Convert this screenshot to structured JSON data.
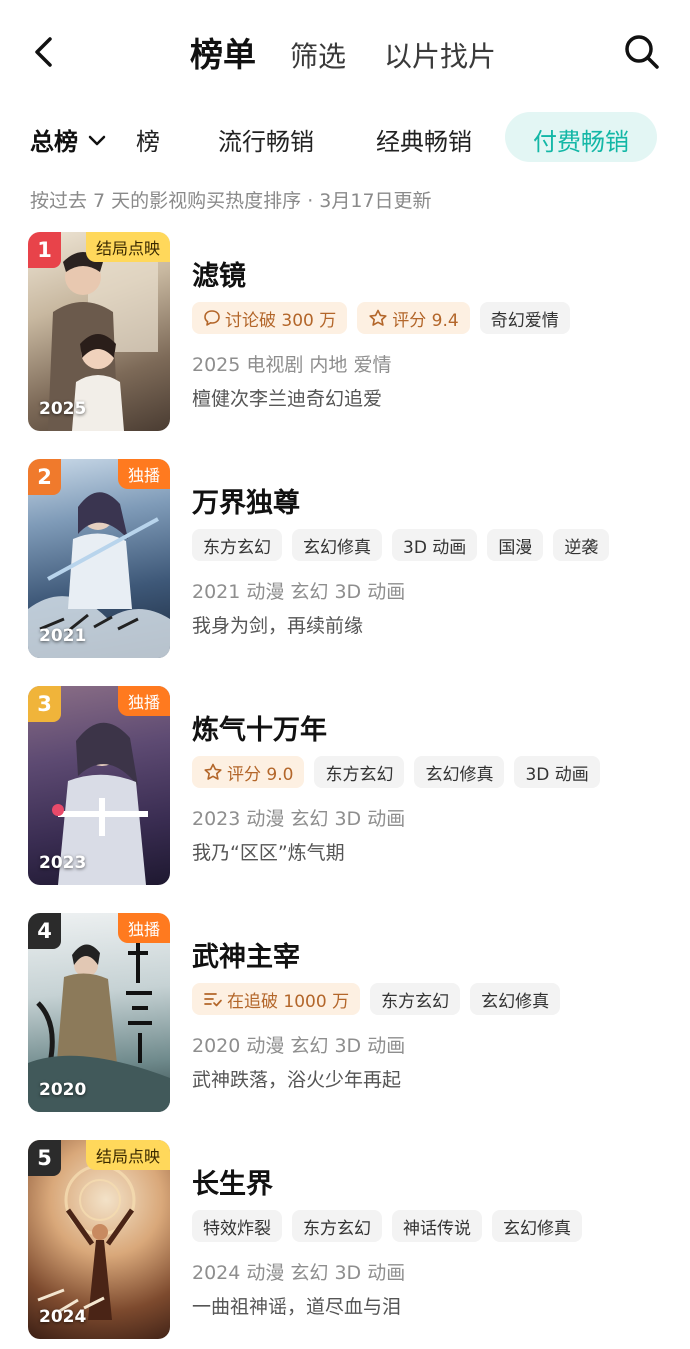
{
  "header": {
    "tabs": [
      {
        "label": "榜单",
        "active": true
      },
      {
        "label": "筛选",
        "active": false
      },
      {
        "label": "以片找片",
        "active": false
      }
    ]
  },
  "categories": {
    "main_label": "总榜",
    "tabs": [
      {
        "label": "榜",
        "active": false
      },
      {
        "label": "流行畅销",
        "active": false
      },
      {
        "label": "经典畅销",
        "active": false
      },
      {
        "label": "付费畅销",
        "active": true
      }
    ]
  },
  "subtitle": "按过去 7 天的影视购买热度排序 · 3月17日更新",
  "colors": {
    "accent": "#13b7a6",
    "accent_bg": "#e3f6f4",
    "rank_red": "#e8434a",
    "rank_orange": "#f07a2c",
    "rank_gold": "#f0b43a",
    "rank_dark": "#2b2b2b",
    "badge_yellow": "#ffd85b",
    "badge_orange": "#ff7a1f",
    "tag_highlight_bg": "#fdf0e2",
    "tag_highlight_text": "#b3662a"
  },
  "items": [
    {
      "rank": "1",
      "badge": "结局点映",
      "badge_style": "yellow",
      "year": "2025",
      "title": "滤镜",
      "tags": [
        {
          "label": "讨论破 300 万",
          "highlight": true,
          "icon": "comment-icon"
        },
        {
          "label": "评分 9.4",
          "highlight": true,
          "icon": "star-icon"
        },
        {
          "label": "奇幻爱情",
          "highlight": false
        }
      ],
      "meta": "2025 电视剧 内地 爱情",
      "desc": "檀健次李兰迪奇幻追爱"
    },
    {
      "rank": "2",
      "badge": "独播",
      "badge_style": "orange",
      "year": "2021",
      "title": "万界独尊",
      "tags": [
        {
          "label": "东方玄幻",
          "highlight": false
        },
        {
          "label": "玄幻修真",
          "highlight": false
        },
        {
          "label": "3D 动画",
          "highlight": false
        },
        {
          "label": "国漫",
          "highlight": false
        },
        {
          "label": "逆袭",
          "highlight": false
        }
      ],
      "meta": "2021 动漫 玄幻 3D 动画",
      "desc": "我身为剑，再续前缘"
    },
    {
      "rank": "3",
      "badge": "独播",
      "badge_style": "orange",
      "year": "2023",
      "title": "炼气十万年",
      "tags": [
        {
          "label": "评分 9.0",
          "highlight": true,
          "icon": "star-icon"
        },
        {
          "label": "东方玄幻",
          "highlight": false
        },
        {
          "label": "玄幻修真",
          "highlight": false
        },
        {
          "label": "3D 动画",
          "highlight": false
        }
      ],
      "meta": "2023 动漫 玄幻 3D 动画",
      "desc": "我乃“区区”炼气期"
    },
    {
      "rank": "4",
      "badge": "独播",
      "badge_style": "orange",
      "year": "2020",
      "title": "武神主宰",
      "tags": [
        {
          "label": "在追破 1000 万",
          "highlight": true,
          "icon": "list-check-icon"
        },
        {
          "label": "东方玄幻",
          "highlight": false
        },
        {
          "label": "玄幻修真",
          "highlight": false
        }
      ],
      "meta": "2020 动漫 玄幻 3D 动画",
      "desc": "武神跌落，浴火少年再起"
    },
    {
      "rank": "5",
      "badge": "结局点映",
      "badge_style": "yellow",
      "year": "2024",
      "title": "长生界",
      "tags": [
        {
          "label": "特效炸裂",
          "highlight": false
        },
        {
          "label": "东方玄幻",
          "highlight": false
        },
        {
          "label": "神话传说",
          "highlight": false
        },
        {
          "label": "玄幻修真",
          "highlight": false
        }
      ],
      "meta": "2024 动漫 玄幻 3D 动画",
      "desc": "一曲祖神谣，道尽血与泪"
    }
  ]
}
